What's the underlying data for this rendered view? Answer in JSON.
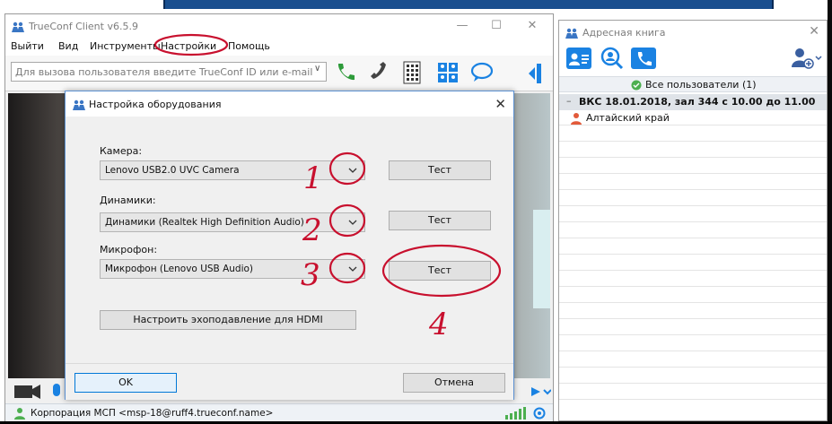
{
  "client": {
    "title": "TrueConf Client v6.5.9",
    "menu": [
      "Выйти",
      "Вид",
      "Инструменты",
      "Настройки",
      "Помощь"
    ],
    "call_placeholder": "Для вызова пользователя введите TrueConf ID  или e-mail",
    "status_text": "Корпорация МСП <msp-18@ruff4.trueconf.name>"
  },
  "dialog": {
    "title": "Настройка оборудования",
    "camera_label": "Камера:",
    "camera_value": "Lenovo USB2.0 UVC Camera",
    "speakers_label": "Динамики:",
    "speakers_value": "Динамики (Realtek High Definition Audio)",
    "mic_label": "Микрофон:",
    "mic_value": "Микрофон (Lenovo USB Audio)",
    "test_label": "Тест",
    "hdmi_label": "Настроить эхоподавление для HDMI",
    "ok_label": "OK",
    "cancel_label": "Отмена"
  },
  "annotations": [
    "1",
    "2",
    "3",
    "4"
  ],
  "address_book": {
    "title": "Адресная книга",
    "all_users": "Все пользователи (1)",
    "group": "ВКС 18.01.2018, зал 344 с 10.00 до 11.00",
    "contact": "Алтайский край"
  },
  "colors": {
    "accent": "#1a82e2",
    "annotation": "#c8102e",
    "online": "#4caf50",
    "call_green": "#2e9b3a"
  }
}
